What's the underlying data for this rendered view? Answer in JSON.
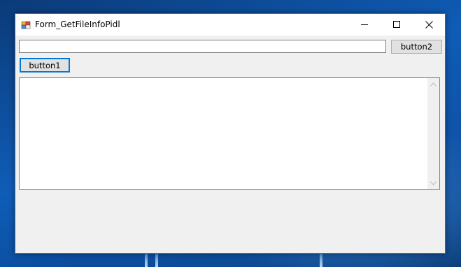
{
  "window": {
    "title": "Form_GetFileInfoPidl",
    "icon": "winforms-app-icon",
    "controls": {
      "minimize_icon": "minimize-icon",
      "maximize_icon": "maximize-icon",
      "close_icon": "close-icon"
    }
  },
  "form": {
    "path_input": {
      "value": "",
      "placeholder": ""
    },
    "button2_label": "button2",
    "button1_label": "button1",
    "output_text": ""
  },
  "colors": {
    "focus_border": "#0078d7",
    "button_face": "#e1e1e1",
    "form_background": "#f0f0f0"
  }
}
